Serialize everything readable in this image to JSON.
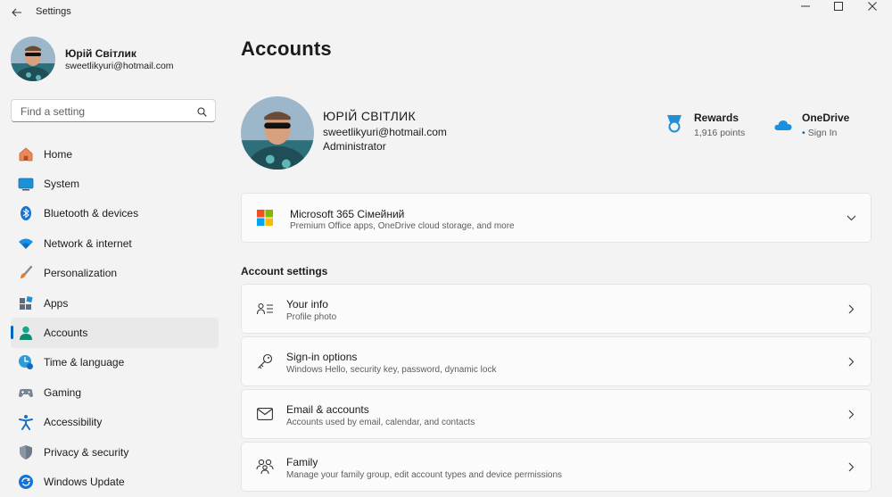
{
  "window": {
    "title": "Settings",
    "controls": [
      "minimize",
      "maximize",
      "close"
    ]
  },
  "user": {
    "name": "Юрій Світлик",
    "email": "sweetlikyuri@hotmail.com"
  },
  "search": {
    "placeholder": "Find a setting"
  },
  "nav": [
    {
      "label": "Home",
      "icon": "home-icon"
    },
    {
      "label": "System",
      "icon": "system-icon"
    },
    {
      "label": "Bluetooth & devices",
      "icon": "bluetooth-icon"
    },
    {
      "label": "Network & internet",
      "icon": "wifi-icon"
    },
    {
      "label": "Personalization",
      "icon": "brush-icon"
    },
    {
      "label": "Apps",
      "icon": "apps-icon"
    },
    {
      "label": "Accounts",
      "icon": "accounts-icon",
      "selected": true
    },
    {
      "label": "Time & language",
      "icon": "time-language-icon"
    },
    {
      "label": "Gaming",
      "icon": "gamepad-icon"
    },
    {
      "label": "Accessibility",
      "icon": "accessibility-icon"
    },
    {
      "label": "Privacy & security",
      "icon": "shield-icon"
    },
    {
      "label": "Windows Update",
      "icon": "update-icon"
    }
  ],
  "main": {
    "title": "Accounts",
    "profile": {
      "name": "ЮРІЙ СВІТЛИК",
      "email": "sweetlikyuri@hotmail.com",
      "role": "Administrator"
    },
    "rewards": {
      "title": "Rewards",
      "points": "1,916 points"
    },
    "onedrive": {
      "title": "OneDrive",
      "status": "Sign In"
    },
    "m365": {
      "title": "Microsoft 365 Сімейний",
      "subtitle": "Premium Office apps, OneDrive cloud storage, and more"
    },
    "section_title": "Account settings",
    "settings": [
      {
        "title": "Your info",
        "subtitle": "Profile photo",
        "icon": "your-info-icon"
      },
      {
        "title": "Sign-in options",
        "subtitle": "Windows Hello, security key, password, dynamic lock",
        "icon": "key-icon"
      },
      {
        "title": "Email & accounts",
        "subtitle": "Accounts used by email, calendar, and contacts",
        "icon": "mail-icon"
      },
      {
        "title": "Family",
        "subtitle": "Manage your family group, edit account types and device permissions",
        "icon": "family-icon"
      }
    ]
  },
  "colors": {
    "accent": "#0067c0",
    "background": "#f3f3f3",
    "card": "#fbfbfb"
  }
}
